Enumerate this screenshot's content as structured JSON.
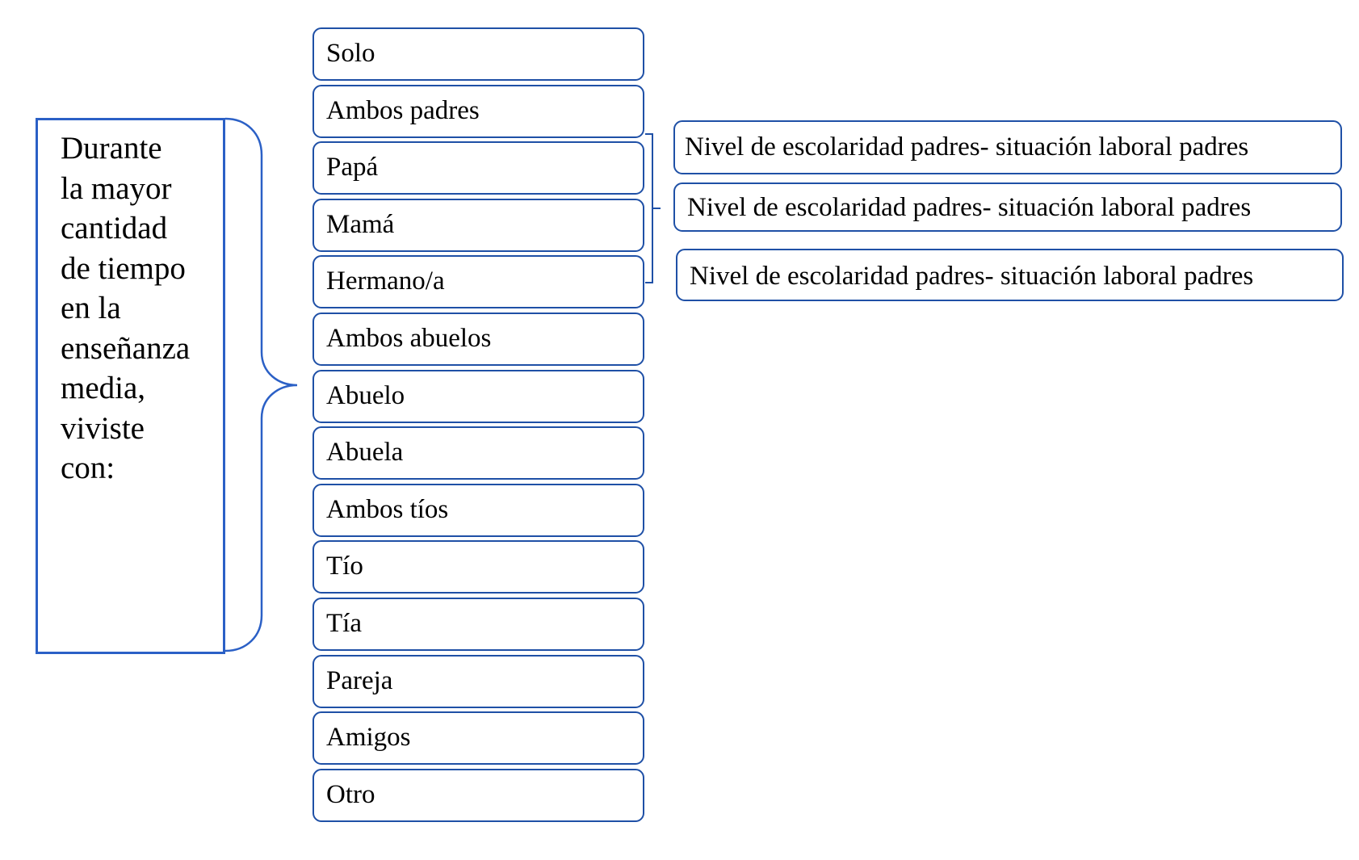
{
  "question": {
    "text": "Durante\nla mayor\ncantidad\nde tiempo\nen la\nenseñanza\nmedia,\nviviste\ncon:"
  },
  "options": [
    {
      "label": "Solo"
    },
    {
      "label": "Ambos padres"
    },
    {
      "label": "Papá"
    },
    {
      "label": "Mamá"
    },
    {
      "label": "Hermano/a"
    },
    {
      "label": "Ambos abuelos"
    },
    {
      "label": "Abuelo"
    },
    {
      "label": "Abuela"
    },
    {
      "label": "Ambos tíos"
    },
    {
      "label": "Tío"
    },
    {
      "label": "Tía"
    },
    {
      "label": "Pareja"
    },
    {
      "label": "Amigos"
    },
    {
      "label": "Otro"
    }
  ],
  "follow_ups": [
    {
      "label": "Nivel de escolaridad padres- situación laboral padres"
    },
    {
      "label": "Nivel de escolaridad padres- situación laboral padres"
    },
    {
      "label": "Nivel de escolaridad padres- situación laboral padres"
    }
  ],
  "colors": {
    "question_border": "#2b60c6",
    "box_border": "#1f50a6"
  }
}
